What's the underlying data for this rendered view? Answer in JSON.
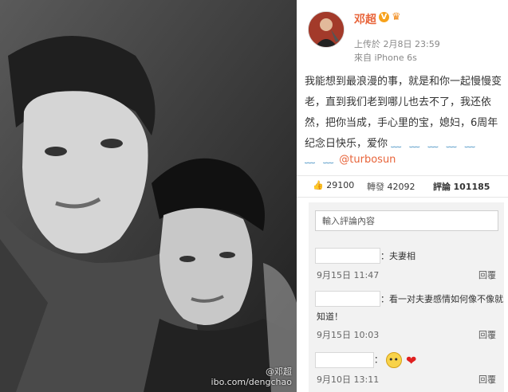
{
  "photo": {
    "watermark_line1": "@邓超",
    "watermark_line2": "ibo.com/dengchao"
  },
  "post": {
    "username": "邓超",
    "verified_mark": "V",
    "posted": "上传於 2月8日 23:59",
    "source": "來自 iPhone 6s",
    "content": "我能想到最浪漫的事，就是和你一起慢慢变老，直到我们老到哪儿也去不了，我还依然，把你当成，手心里的宝，媳妇，6周年纪念日快乐，爱你",
    "wavy": "﹏ ﹏ ﹏ ﹏ ﹏",
    "wavy_prefix": "﹏ ﹏",
    "mention": "@turbosun"
  },
  "actions": {
    "likes": "29100",
    "repost_label": "轉發",
    "reposts": "42092",
    "comment_label": "評論",
    "comments": "101185"
  },
  "comments": {
    "input_placeholder": "輸入評論內容",
    "items": [
      {
        "text": "：夫妻相",
        "time": "9月15日 11:47",
        "reply": "回覆"
      },
      {
        "text": "：看一对夫妻感情如何像不像就",
        "text2": "知道！",
        "time": "9月15日 10:03",
        "reply": "回覆"
      },
      {
        "text": "：",
        "time": "9月10日 13:11",
        "reply": "回覆"
      }
    ]
  },
  "colors": {
    "accent_orange": "#e8643a",
    "link_blue": "#3b8abf"
  }
}
